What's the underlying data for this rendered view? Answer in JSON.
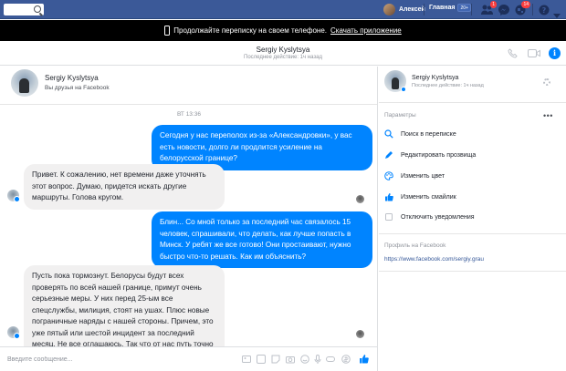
{
  "topbar": {
    "user_name": "Алексей",
    "home_label": "Главная",
    "home_count": "20+",
    "friends_count": "1",
    "notif_count": "14"
  },
  "banner": {
    "text": "Продолжайте переписку на своем телефоне.",
    "link": "Скачать приложение"
  },
  "conversation": {
    "name": "Sergiy Kyslytsya",
    "status": "Последнее действие: 1ч назад"
  },
  "intro": {
    "name": "Sergiy Kyslytsya",
    "subtitle": "Вы друзья на Facebook"
  },
  "timestamp": "ВТ 13:36",
  "messages": [
    {
      "direction": "out",
      "text": "Сегодня у нас переполох из-за «Александровки», у вас есть новости, долго ли продлится усиление на белорусской границе?"
    },
    {
      "direction": "in",
      "text": "Привет. К сожалению, нет времени даже уточнять этот вопрос. Думаю, придется искать другие маршруты. Голова кругом."
    },
    {
      "direction": "out",
      "text": "Блин... Со мной только за последний час связалось 15 человек, спрашивали, что делать, как лучше попасть в Минск. У ребят же все готово! Они простаивают, нужно быстро что-то решать. Как им объяснить?"
    },
    {
      "direction": "in",
      "text": "Пусть пока тормознут. Белорусы будут всех проверять по всей нашей границе, примут очень серьезные меры. У них перед 25-ым все спецслужбы, милиция, стоят на ушах. Плюс новые пограничные наряды с нашей стороны. Причем, это уже пятый или шестой инцидент за последний месяц. Не все оглашаюсь. Так что от нас путь точно закрыт."
    }
  ],
  "composer": {
    "placeholder": "Введите сообщение..."
  },
  "panel": {
    "name": "Sergiy Kyslytsya",
    "status": "Последнее действие: 1ч назад",
    "settings_title": "Параметры",
    "options": [
      {
        "label": "Поиск в переписке",
        "icon": "search-icon"
      },
      {
        "label": "Редактировать прозвища",
        "icon": "pencil-icon"
      },
      {
        "label": "Изменить цвет",
        "icon": "palette-icon"
      },
      {
        "label": "Изменить смайлик",
        "icon": "thumbs-up-icon"
      },
      {
        "label": "Отключить уведомления",
        "icon": "checkbox-icon"
      }
    ],
    "profile_title": "Профиль на Facebook",
    "profile_url": "https://www.facebook.com/sergiy.grau"
  },
  "colors": {
    "facebook_blue": "#3b5998",
    "messenger_blue": "#0084ff",
    "incoming_bubble": "#f1f0f0"
  }
}
